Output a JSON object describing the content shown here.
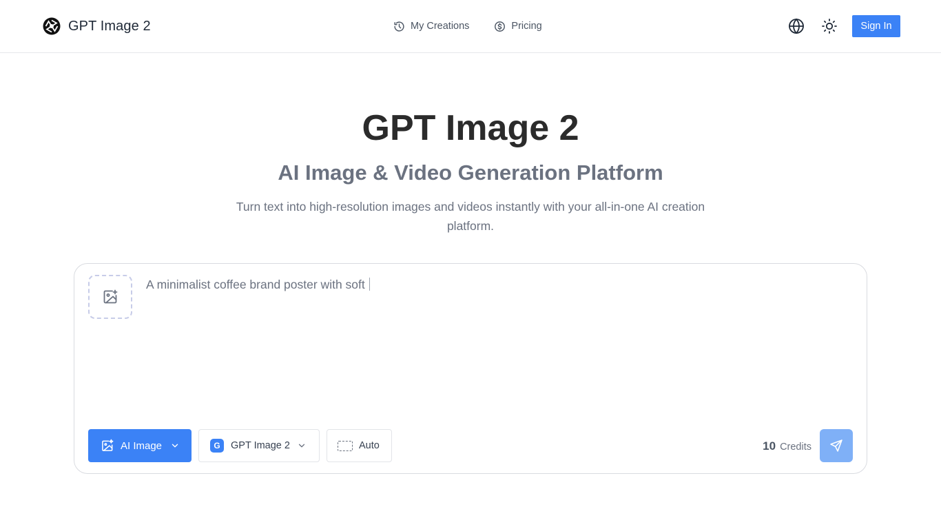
{
  "header": {
    "brand_name": "GPT Image 2",
    "logo_icon": "aperture-logo-icon",
    "nav": [
      {
        "label": "My Creations",
        "icon": "clock-history-icon"
      },
      {
        "label": "Pricing",
        "icon": "dollar-circle-icon"
      }
    ],
    "language_icon": "globe-icon",
    "theme_icon": "sun-icon",
    "signin_label": "Sign In"
  },
  "hero": {
    "title": "GPT Image 2",
    "subtitle": "AI Image & Video Generation Platform",
    "description": "Turn text into high-resolution images and videos instantly with your all-in-one AI creation platform."
  },
  "composer": {
    "upload_icon": "image-plus-icon",
    "prompt_text": "A minimalist coffee brand poster with soft",
    "mode": {
      "label": "AI Image",
      "icon": "image-sparkle-icon"
    },
    "model": {
      "badge": "G",
      "label": "GPT Image 2"
    },
    "ratio": {
      "label": "Auto",
      "icon": "dashed-rect-icon"
    },
    "credits_value": "10",
    "credits_label": "Credits",
    "send_icon": "send-icon"
  },
  "colors": {
    "accent": "#3b82f6",
    "send_disabled": "#7fb0f7",
    "text_primary": "#2b2b2b",
    "text_muted": "#6b7280"
  }
}
